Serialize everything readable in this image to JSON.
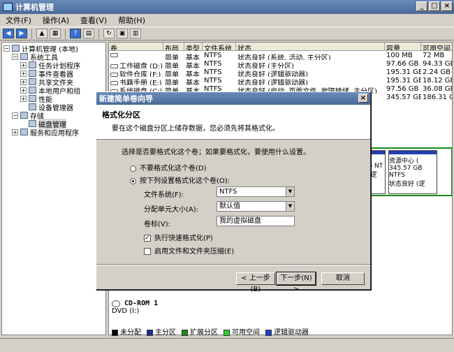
{
  "window": {
    "title": "计算机管理",
    "controls": [
      "_",
      "□",
      "×"
    ]
  },
  "menu": [
    "文件(F)",
    "操作(A)",
    "查看(V)",
    "帮助(H)"
  ],
  "tree": [
    {
      "label": "计算机管理 (本地)",
      "indent": 0,
      "exp": "⊟"
    },
    {
      "label": "系统工具",
      "indent": 1,
      "exp": "⊟"
    },
    {
      "label": "任务计划程序",
      "indent": 2,
      "exp": "⊞"
    },
    {
      "label": "事件查看器",
      "indent": 2,
      "exp": "⊞"
    },
    {
      "label": "共享文件夹",
      "indent": 2,
      "exp": "⊞"
    },
    {
      "label": "本地用户和组",
      "indent": 2,
      "exp": "⊞"
    },
    {
      "label": "性能",
      "indent": 2,
      "exp": "⊞"
    },
    {
      "label": "设备管理器",
      "indent": 2,
      "exp": ""
    },
    {
      "label": "存储",
      "indent": 1,
      "exp": "⊟"
    },
    {
      "label": "磁盘管理",
      "indent": 2,
      "exp": "",
      "selected": true
    },
    {
      "label": "服务和应用程序",
      "indent": 1,
      "exp": "⊞"
    }
  ],
  "volumes": {
    "headers": [
      "卷",
      "布局",
      "类型",
      "文件系统",
      "状态",
      "容量",
      "可用空间"
    ],
    "rows": [
      [
        "",
        "简单",
        "基本",
        "NTFS",
        "状态良好 (系统, 活动, 主分区)",
        "100 MB",
        "72 MB"
      ],
      [
        "工作磁盘 (D:)",
        "简单",
        "基本",
        "NTFS",
        "状态良好 (主分区)",
        "97.66 GB",
        "94.33 GB"
      ],
      [
        "软件仓库 (F:)",
        "简单",
        "基本",
        "NTFS",
        "状态良好 (逻辑驱动器)",
        "195.31 GB",
        "2.24 GB"
      ],
      [
        "书籍手册 (E:)",
        "简单",
        "基本",
        "NTFS",
        "状态良好 (逻辑驱动器)",
        "195.31 GB",
        "18.12 GB"
      ],
      [
        "系统磁盘 (C:)",
        "简单",
        "基本",
        "NTFS",
        "状态良好 (启动, 页面文件, 故障转储, 主分区)",
        "97.56 GB",
        "36.08 GB"
      ],
      [
        "",
        "",
        "",
        "",
        "",
        "345.57 GB",
        "186.31 GB"
      ]
    ]
  },
  "dialog": {
    "title": "新建简单卷向导",
    "heading": "格式化分区",
    "subheading": "要在这个磁盘分区上储存数据，您必须先将其格式化。",
    "prompt": "选择是否要格式化这个卷；如果要格式化，要使用什么设置。",
    "opt_noformat": "不要格式化这个卷(D)",
    "opt_format": "按下列设置格式化这个卷(O):",
    "fs_label": "文件系统(F):",
    "fs_value": "NTFS",
    "alloc_label": "分配单元大小(A):",
    "alloc_value": "默认值",
    "vol_label": "卷标(V):",
    "vol_value": "我的虚拟磁盘",
    "quick_format": "执行快速格式化(P)",
    "compress": "启用文件和文件夹压缩(E)",
    "back_btn": "< 上一步(B)",
    "next_btn": "下一步(N) >",
    "cancel_btn": "取消"
  },
  "disk_graphic": {
    "box1": {
      "l1": "(",
      "l2": "B NT",
      "l3": "(逻"
    },
    "box2": {
      "l1": "资源中心 (",
      "l2": "345.57 GB NTFS",
      "l3": "状态良好 (逻"
    }
  },
  "cdrom": {
    "name": "CD-ROM 1",
    "type": "DVD (I:)"
  },
  "legend": [
    {
      "label": "未分配",
      "color": "#000000"
    },
    {
      "label": "主分区",
      "color": "#1a2aa0"
    },
    {
      "label": "扩展分区",
      "color": "#1a8a1a"
    },
    {
      "label": "可用空间",
      "color": "#30d030"
    },
    {
      "label": "逻辑驱动器",
      "color": "#2040d0"
    }
  ]
}
